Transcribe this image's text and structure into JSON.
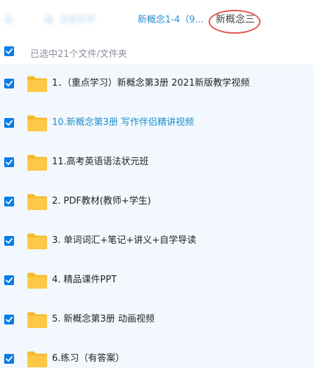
{
  "breadcrumb": {
    "items": [
      {
        "label": "返",
        "obscured": true
      },
      {
        "label": "级",
        "obscured": true
      },
      {
        "label": "全部文件",
        "obscured": true
      },
      {
        "label": "新概念1-4（9...",
        "obscured": false
      }
    ],
    "current": "新概念三",
    "highlight_color": "#e0524c"
  },
  "selection": {
    "summary": "已选中21个文件/文件夹",
    "checked": true
  },
  "files": [
    {
      "name": "1．（重点学习）新概念第3册 2021新版教学视频",
      "type": "folder",
      "checked": true,
      "highlighted": false
    },
    {
      "name": "10.新概念第3册 写作伴侣精讲视频",
      "type": "folder",
      "checked": true,
      "highlighted": true
    },
    {
      "name": "11.高考英语语法状元班",
      "type": "folder",
      "checked": true,
      "highlighted": false
    },
    {
      "name": "2. PDF教材(教师+学生)",
      "type": "folder",
      "checked": true,
      "highlighted": false
    },
    {
      "name": "3. 单词词汇+笔记+讲义+自学导读",
      "type": "folder",
      "checked": true,
      "highlighted": false
    },
    {
      "name": "4. 精品课件PPT",
      "type": "folder",
      "checked": true,
      "highlighted": false
    },
    {
      "name": "5. 新概念第3册 动画视频",
      "type": "folder",
      "checked": true,
      "highlighted": false
    },
    {
      "name": "6.练习（有答案）",
      "type": "folder",
      "checked": true,
      "highlighted": false
    }
  ],
  "colors": {
    "accent": "#0a7de6",
    "link": "#1d8dd0",
    "list_background": "#f2f8fd",
    "folder": "#f8c23a"
  },
  "icons": {
    "checkbox": "checkbox-checked-icon",
    "folder": "folder-icon"
  }
}
